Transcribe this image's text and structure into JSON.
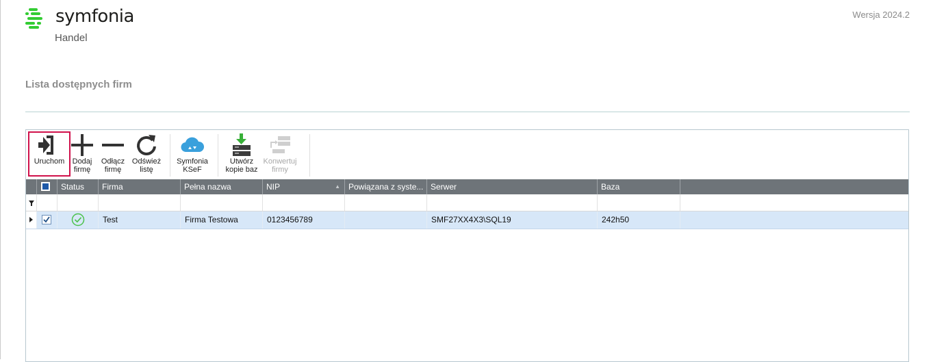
{
  "app": {
    "logo_name": "symfonia",
    "logo_subtitle": "Handel",
    "version": "Wersja 2024.2",
    "brand_color": "#33cc33"
  },
  "page": {
    "title": "Lista dostępnych firm"
  },
  "toolbar": {
    "buttons": [
      {
        "icon": "login-arrow-icon",
        "line1": "Uruchom",
        "line2": "",
        "selected": true,
        "enabled": true
      },
      {
        "icon": "plus-icon",
        "line1": "Dodaj",
        "line2": "firmę",
        "enabled": true
      },
      {
        "icon": "minus-icon",
        "line1": "Odłącz",
        "line2": "firmę",
        "enabled": true
      },
      {
        "icon": "refresh-icon",
        "line1": "Odśwież",
        "line2": "listę",
        "enabled": true
      },
      {
        "icon": "cloud-icon",
        "line1": "Symfonia",
        "line2": "KSeF",
        "enabled": true
      },
      {
        "icon": "database-download-icon",
        "line1": "Utwórz",
        "line2": "kopie baz",
        "enabled": true
      },
      {
        "icon": "convert-servers-icon",
        "line1": "Konwertuj",
        "line2": "firmy",
        "enabled": false
      }
    ],
    "selected_border_color": "#d0104a"
  },
  "grid": {
    "columns": [
      "Status",
      "Firma",
      "Pełna nazwa",
      "NIP",
      "Powiązana z syste...",
      "Serwer",
      "Baza"
    ],
    "sort_indicator": "▲",
    "filter_icon": "funnel-icon",
    "rows": [
      {
        "checked": true,
        "status": "ok",
        "firma": "Test",
        "pelna_nazwa": "Firma Testowa",
        "nip": "0123456789",
        "powiazana": "",
        "serwer": "SMF27XX4X3\\SQL19",
        "baza": "242h50"
      }
    ],
    "header_color": "#6e7479",
    "selected_row_color": "#d7e7f8"
  }
}
